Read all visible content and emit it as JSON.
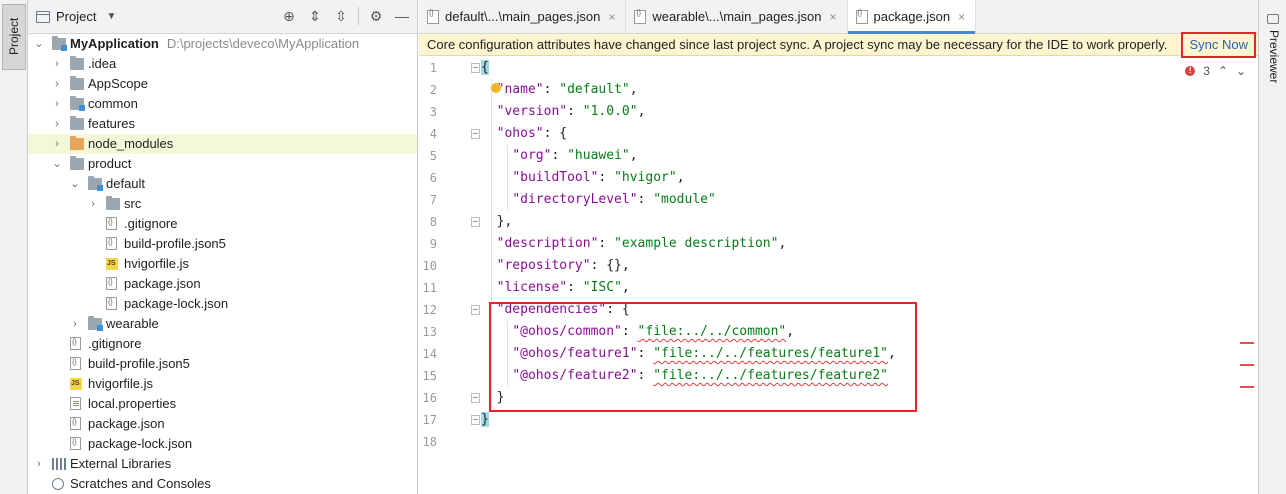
{
  "left_strip": {
    "project_tab": "Project"
  },
  "right_strip": {
    "previewer_tab": "Previewer"
  },
  "project_panel": {
    "title": "Project",
    "tree": [
      {
        "label": "MyApplication",
        "path": "D:\\projects\\deveco\\MyApplication",
        "icon": "module-folder-icon",
        "indent": 0,
        "arrow": "expanded"
      },
      {
        "label": ".idea",
        "icon": "folder-icon",
        "indent": 1,
        "arrow": "collapsed"
      },
      {
        "label": "AppScope",
        "icon": "folder-icon",
        "indent": 1,
        "arrow": "collapsed"
      },
      {
        "label": "common",
        "icon": "module-folder-icon",
        "indent": 1,
        "arrow": "collapsed"
      },
      {
        "label": "features",
        "icon": "folder-icon",
        "indent": 1,
        "arrow": "collapsed"
      },
      {
        "label": "node_modules",
        "icon": "excluded-folder-icon",
        "indent": 1,
        "arrow": "collapsed",
        "selected": true
      },
      {
        "label": "product",
        "icon": "folder-icon",
        "indent": 1,
        "arrow": "expanded"
      },
      {
        "label": "default",
        "icon": "module-folder-icon",
        "indent": 2,
        "arrow": "expanded"
      },
      {
        "label": "src",
        "icon": "folder-icon",
        "indent": 3,
        "arrow": "collapsed"
      },
      {
        "label": ".gitignore",
        "icon": "file-icon",
        "indent": 3
      },
      {
        "label": "build-profile.json5",
        "icon": "json-file-icon",
        "indent": 3
      },
      {
        "label": "hvigorfile.js",
        "icon": "js-file-icon",
        "indent": 3
      },
      {
        "label": "package.json",
        "icon": "json-file-icon",
        "indent": 3
      },
      {
        "label": "package-lock.json",
        "icon": "json-file-icon",
        "indent": 3
      },
      {
        "label": "wearable",
        "icon": "module-folder-icon",
        "indent": 2,
        "arrow": "collapsed"
      },
      {
        "label": ".gitignore",
        "icon": "file-icon",
        "indent": 1
      },
      {
        "label": "build-profile.json5",
        "icon": "json-file-icon",
        "indent": 1
      },
      {
        "label": "hvigorfile.js",
        "icon": "js-file-icon",
        "indent": 1
      },
      {
        "label": "local.properties",
        "icon": "properties-file-icon",
        "indent": 1
      },
      {
        "label": "package.json",
        "icon": "json-file-icon",
        "indent": 1
      },
      {
        "label": "package-lock.json",
        "icon": "json-file-icon",
        "indent": 1
      },
      {
        "label": "External Libraries",
        "icon": "library-icon",
        "indent": 0,
        "arrow": "collapsed"
      },
      {
        "label": "Scratches and Consoles",
        "icon": "scratch-icon",
        "indent": 0
      }
    ]
  },
  "editor": {
    "tabs": [
      {
        "label": "default\\...\\main_pages.json",
        "active": false
      },
      {
        "label": "wearable\\...\\main_pages.json",
        "active": false
      },
      {
        "label": "package.json",
        "active": true
      }
    ],
    "banner": {
      "message": "Core configuration attributes have changed since last project sync. A project sync may be necessary for the IDE to work properly.",
      "action": "Sync Now"
    },
    "error_count": "3",
    "line_numbers": [
      "1",
      "2",
      "3",
      "4",
      "5",
      "6",
      "7",
      "8",
      "9",
      "10",
      "11",
      "12",
      "13",
      "14",
      "15",
      "16",
      "17",
      "18"
    ]
  },
  "colors": {
    "key": "#871094",
    "string": "#067d17",
    "highlight_border": "#e0262b",
    "link": "#2a62b8",
    "banner_bg": "#fdf5d0"
  }
}
